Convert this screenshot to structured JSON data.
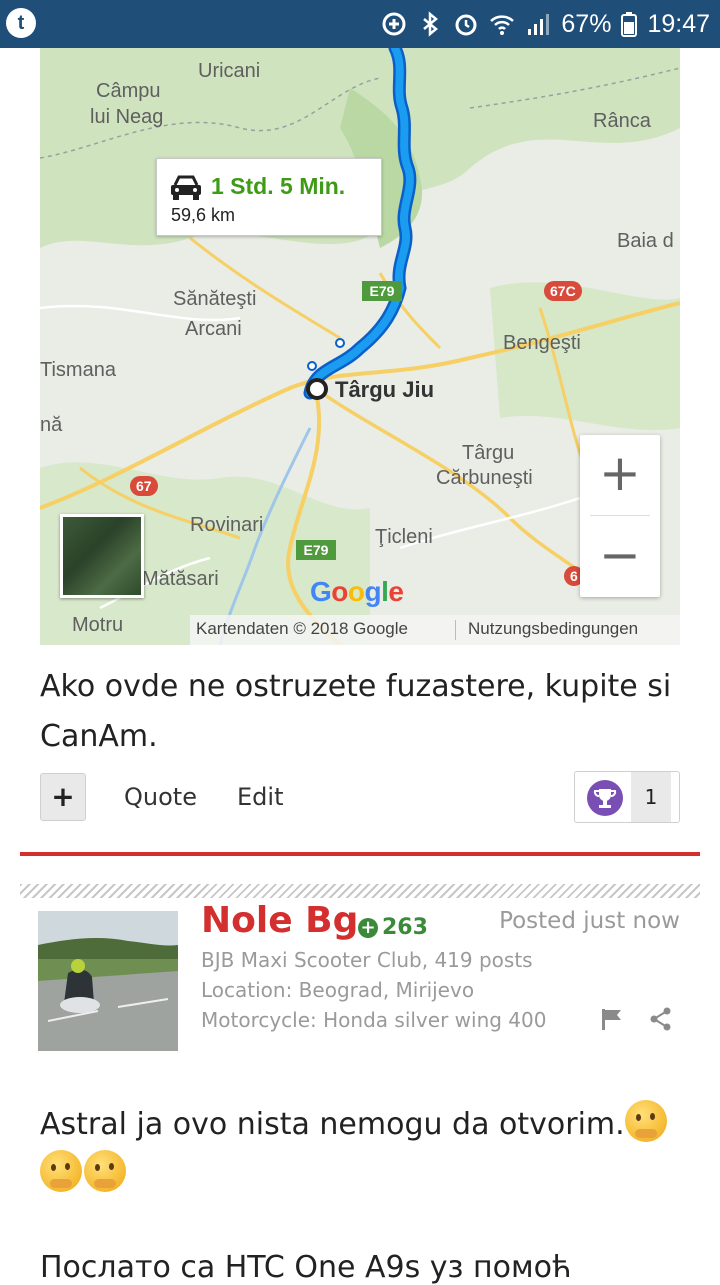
{
  "status_bar": {
    "battery_percent": "67%",
    "time": "19:47",
    "app_icon_letter": "t"
  },
  "map": {
    "route": {
      "duration": "1 Std. 5 Min.",
      "distance": "59,6 km"
    },
    "destination": "Târgu Jiu",
    "places": {
      "uricani": "Uricani",
      "campu": "Câmpu",
      "lui_neag": "lui Neag",
      "ranca": "Rânca",
      "baia": "Baia d",
      "sanatesti": "Sănăteşti",
      "arcani": "Arcani",
      "bengesti": "Bengeşti",
      "tismana": "Tismana",
      "na": "nă",
      "targu": "Târgu",
      "carbunesti": "Cărbuneşti",
      "rovinari": "Rovinari",
      "ticleni": "Ţicleni",
      "matasari": "Mătăsari",
      "motru": "Motru"
    },
    "road_badges": {
      "e79_top": "E79",
      "e79_bottom": "E79",
      "r67c": "67C",
      "r67": "67",
      "r6": "6"
    },
    "zoom_in": "+",
    "zoom_out": "−",
    "google_logo": "Google",
    "attribution": "Kartendaten © 2018 Google",
    "terms": "Nutzungsbedingungen"
  },
  "post1": {
    "text": "Ako ovde ne ostruzete fuzastere, kupite si CanAm.",
    "plus_label": "+",
    "quote_label": "Quote",
    "edit_label": "Edit",
    "like_count": "1"
  },
  "post2": {
    "author": "Nole Bg",
    "reputation": "263",
    "posted": "Posted just now",
    "club": "BJB Maxi Scooter Club, 419 posts",
    "location": "Location: Beograd, Mirijevo",
    "motorcycle": "Motorcycle: Honda silver wing 400",
    "text": "Astral ja ovo nista nemogu da otvorim.",
    "footer_text": "Послато са HTC One A9s уз помоћ"
  },
  "colors": {
    "status_bar": "#1f4e79",
    "author": "#d32f2f",
    "reputation": "#3a8a3a",
    "route": "#1a73e8",
    "route_time": "#3d9b16"
  }
}
